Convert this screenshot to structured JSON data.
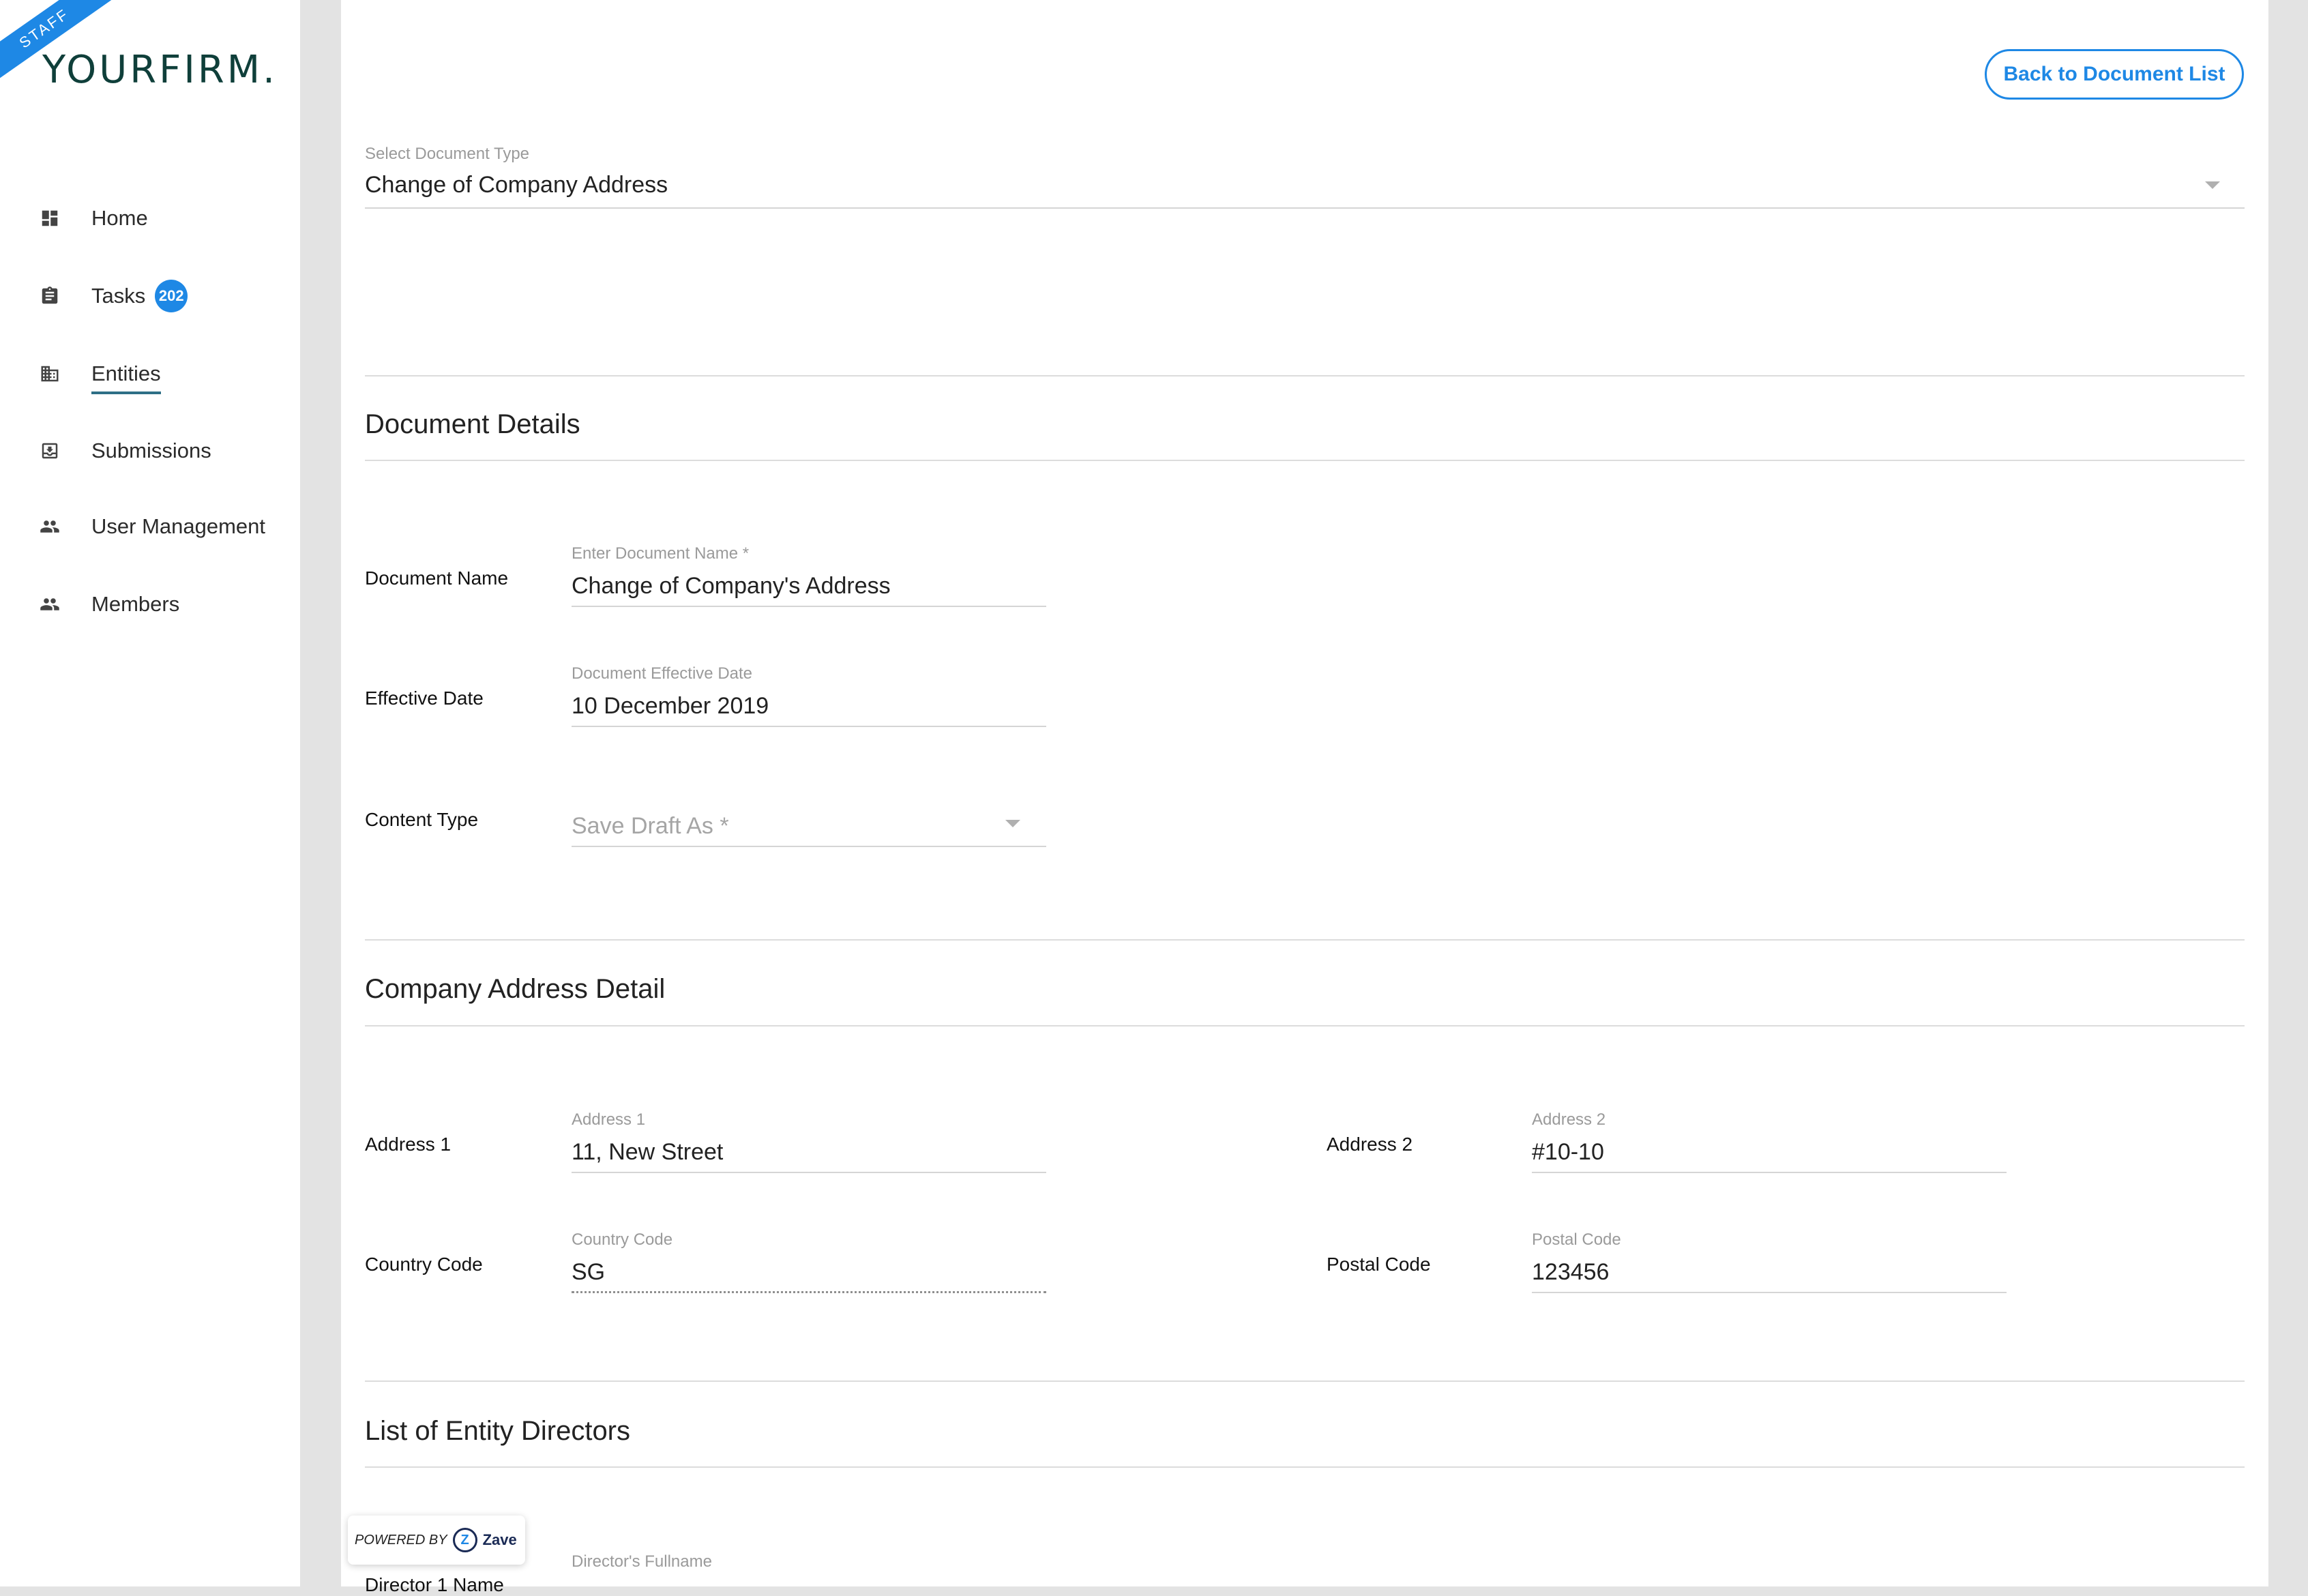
{
  "sidebar": {
    "ribbon": "STAFF",
    "logo": "YOURFIRM.",
    "items": [
      {
        "label": "Home",
        "icon": "dashboard-icon"
      },
      {
        "label": "Tasks",
        "icon": "clipboard-icon",
        "badge": "202"
      },
      {
        "label": "Entities",
        "icon": "building-icon",
        "active": true
      },
      {
        "label": "Submissions",
        "icon": "inbox-icon"
      },
      {
        "label": "User Management",
        "icon": "people-icon"
      },
      {
        "label": "Members",
        "icon": "people-icon"
      }
    ]
  },
  "header": {
    "back_button": "Back to Document List"
  },
  "document_type": {
    "label": "Select Document Type",
    "value": "Change of Company Address"
  },
  "document_details": {
    "title": "Document Details",
    "name_label": "Document Name",
    "name_field_label": "Enter Document Name *",
    "name_value": "Change of Company's Address",
    "date_label": "Effective Date",
    "date_field_label": "Document Effective Date",
    "date_value": "10 December 2019",
    "content_label": "Content Type",
    "content_placeholder": "Save Draft As *"
  },
  "address_detail": {
    "title": "Company Address Detail",
    "address1_label": "Address 1",
    "address1_field_label": "Address 1",
    "address1_value": "11, New Street",
    "address2_label": "Address 2",
    "address2_field_label": "Address 2",
    "address2_value": "#10-10",
    "country_label": "Country Code",
    "country_field_label": "Country Code",
    "country_value": "SG",
    "postal_label": "Postal Code",
    "postal_field_label": "Postal Code",
    "postal_value": "123456"
  },
  "directors": {
    "title": "List of Entity Directors",
    "director1_label": "Director 1 Name",
    "director1_field_label": "Director's Fullname"
  },
  "powered_by": {
    "text": "POWERED BY",
    "brand": "Zave"
  },
  "colors": {
    "accent": "#1e88e5",
    "logo": "#0f3f3a",
    "active_underline": "#2e6f86"
  }
}
